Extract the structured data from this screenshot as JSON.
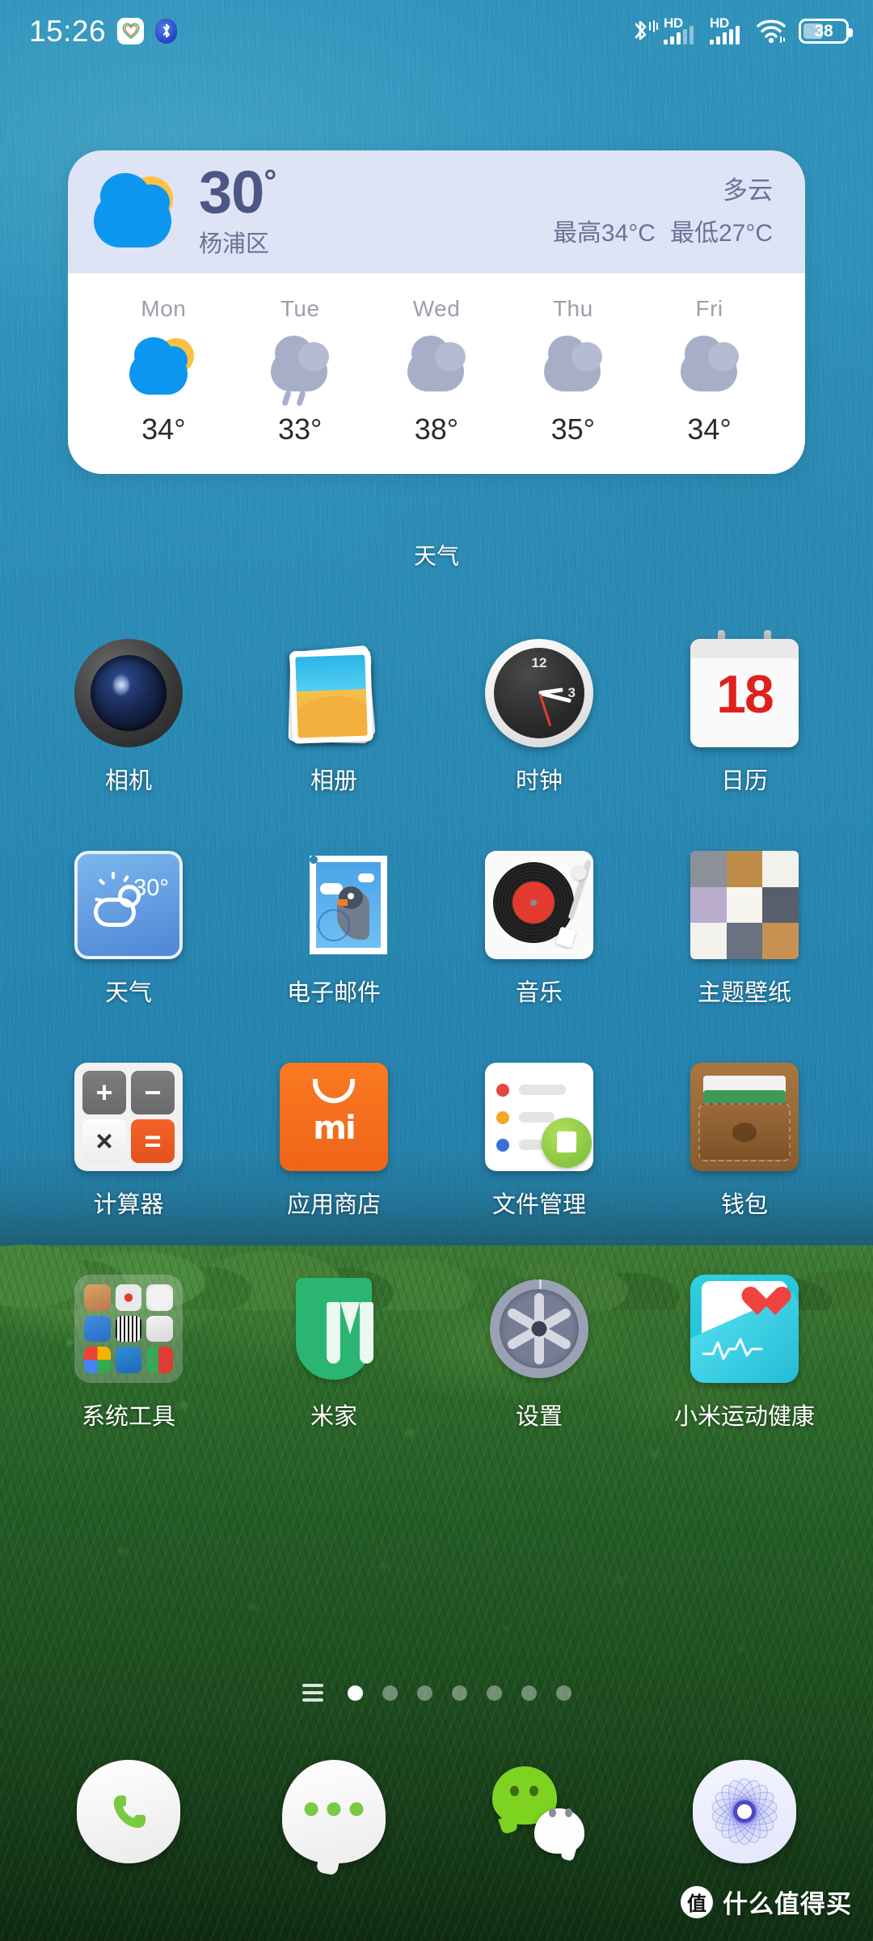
{
  "status_bar": {
    "time": "15:26",
    "health_icon": "heart-icon",
    "bluetooth_left_icon": "bluetooth-icon",
    "bluetooth_right_icon": "bluetooth-audio-icon",
    "sim1": {
      "label": "HD",
      "bars": 5
    },
    "sim2": {
      "label": "HD",
      "bars": 5
    },
    "wifi_icon": "wifi-icon",
    "battery": {
      "percent": "38"
    }
  },
  "weather_widget": {
    "label": "天气",
    "current": {
      "temperature": "30",
      "degree": "°",
      "location": "杨浦区",
      "condition": "多云",
      "high": "最高34°C",
      "low": "最低27°C"
    },
    "forecast": [
      {
        "day": "Mon",
        "temp": "34°",
        "icon": "partly-cloudy-icon"
      },
      {
        "day": "Tue",
        "temp": "33°",
        "icon": "rain-icon"
      },
      {
        "day": "Wed",
        "temp": "38°",
        "icon": "cloudy-icon"
      },
      {
        "day": "Thu",
        "temp": "35°",
        "icon": "cloudy-icon"
      },
      {
        "day": "Fri",
        "temp": "34°",
        "icon": "cloudy-icon"
      }
    ]
  },
  "app_grid": {
    "rows": [
      [
        {
          "label": "相机",
          "icon": "camera-icon"
        },
        {
          "label": "相册",
          "icon": "gallery-icon"
        },
        {
          "label": "时钟",
          "icon": "clock-icon",
          "clock_marks": {
            "twelve": "12",
            "three": "3"
          }
        },
        {
          "label": "日历",
          "icon": "calendar-icon",
          "day": "18"
        }
      ],
      [
        {
          "label": "天气",
          "icon": "weather-app-icon",
          "temp": "30°"
        },
        {
          "label": "电子邮件",
          "icon": "email-stamp-icon"
        },
        {
          "label": "音乐",
          "icon": "music-turntable-icon"
        },
        {
          "label": "主题壁纸",
          "icon": "themes-wallpaper-icon"
        }
      ],
      [
        {
          "label": "计算器",
          "icon": "calculator-icon",
          "keys": [
            "+",
            "−",
            "×",
            "="
          ]
        },
        {
          "label": "应用商店",
          "icon": "app-store-icon",
          "brand": "mi"
        },
        {
          "label": "文件管理",
          "icon": "file-manager-icon"
        },
        {
          "label": "钱包",
          "icon": "wallet-icon"
        }
      ],
      [
        {
          "label": "系统工具",
          "icon": "system-tools-folder-icon"
        },
        {
          "label": "米家",
          "icon": "mijia-icon"
        },
        {
          "label": "设置",
          "icon": "settings-gear-icon"
        },
        {
          "label": "小米运动健康",
          "icon": "mi-fitness-icon"
        }
      ]
    ]
  },
  "page_indicator": {
    "menu_icon": "app-list-icon",
    "total_pages": 7,
    "active_page": 1
  },
  "dock": [
    {
      "label": "phone",
      "icon": "phone-icon"
    },
    {
      "label": "messages",
      "icon": "message-bubble-icon"
    },
    {
      "label": "wechat",
      "icon": "wechat-icon"
    },
    {
      "label": "browser",
      "icon": "browser-flower-icon"
    }
  ],
  "watermark": {
    "badge": "值",
    "text": "什么值得买"
  },
  "colors": {
    "water": "#2f92bb",
    "forest": "#245b25",
    "widget_header": "#dfe3f6",
    "widget_body": "#ffffff",
    "widget_text": "#6a7395",
    "widget_temp": "#4d5785",
    "accent_blue": "#0d96ef",
    "accent_yellow": "#fcc23f",
    "cloud_gray": "#a7afc8",
    "label_white": "#ffffff",
    "calendar_red": "#e0201c",
    "store_orange": "#ef6418",
    "mijia_green": "#2bb573",
    "wechat_green": "#7ed321"
  }
}
